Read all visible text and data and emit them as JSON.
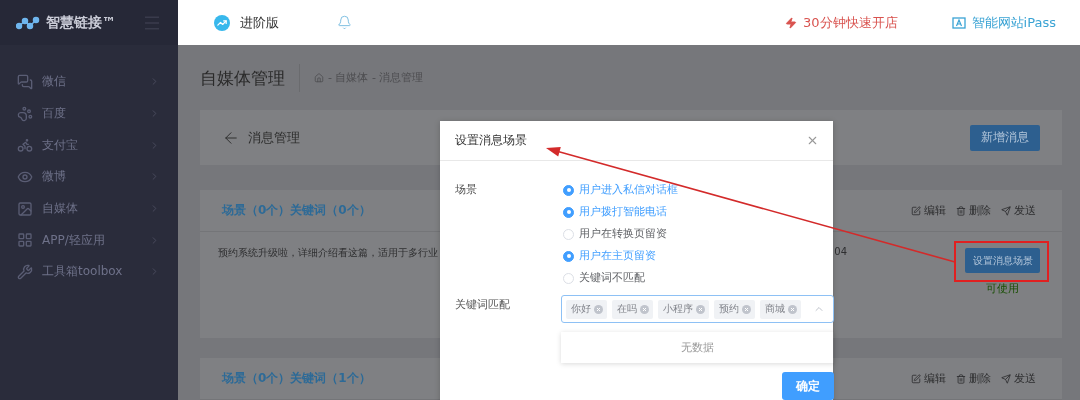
{
  "sidebar": {
    "logo": "智慧链接™",
    "items": [
      {
        "label": "微信"
      },
      {
        "label": "百度"
      },
      {
        "label": "支付宝"
      },
      {
        "label": "微博"
      },
      {
        "label": "自媒体"
      },
      {
        "label": "APP/轻应用"
      },
      {
        "label": "工具箱toolbox"
      }
    ]
  },
  "header": {
    "edition": "进阶版",
    "links": [
      {
        "kind": "flash",
        "label": "30分钟快速开店"
      },
      {
        "kind": "site",
        "label": "智能网站iPass"
      }
    ]
  },
  "page": {
    "title": "自媒体管理",
    "breadcrumb": "- 自媒体 - 消息管理"
  },
  "toolbar": {
    "back_label": "消息管理",
    "new_button": "新增消息"
  },
  "cards": [
    {
      "title": "场景（0个）关键词（0个）",
      "actions": [
        {
          "kind": "edit",
          "label": "编辑"
        },
        {
          "kind": "delete",
          "label": "删除"
        },
        {
          "kind": "send",
          "label": "发送"
        }
      ],
      "description": "预约系统升级啦，详细介绍看这篇，适用于多行业",
      "column_2": "04",
      "scene_button": "设置消息场景",
      "status": "可使用"
    },
    {
      "title": "场景（0个）关键词（1个）",
      "actions": [
        {
          "kind": "edit",
          "label": "编辑"
        },
        {
          "kind": "delete",
          "label": "删除"
        },
        {
          "kind": "send",
          "label": "发送"
        }
      ]
    }
  ],
  "dialog": {
    "title": "设置消息场景",
    "scene_label": "场景",
    "scenes": [
      {
        "label": "用户进入私信对话框",
        "checked": true
      },
      {
        "label": "用户拨打智能电话",
        "checked": true
      },
      {
        "label": "用户在转换页留资",
        "checked": false
      },
      {
        "label": "用户在主页留资",
        "checked": true
      },
      {
        "label": "关键词不匹配",
        "checked": false
      }
    ],
    "keyword_label": "关键词匹配",
    "keywords": [
      "你好",
      "在吗",
      "小程序",
      "预约",
      "商城"
    ],
    "dropdown_empty": "无数据",
    "confirm": "确定"
  }
}
